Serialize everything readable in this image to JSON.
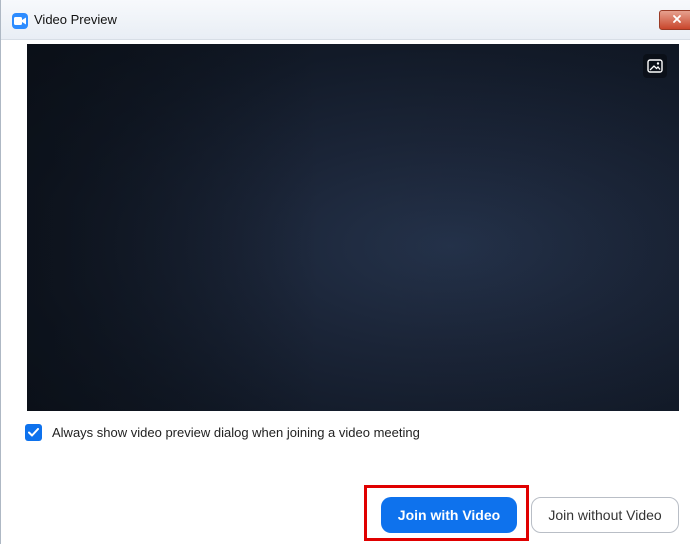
{
  "window": {
    "title": "Video Preview",
    "app_icon": "video-camera-icon",
    "close_icon": "close-icon"
  },
  "preview": {
    "background_icon": "image-background-icon"
  },
  "options": {
    "always_show_label": "Always show video preview dialog when joining a video meeting",
    "always_show_checked": true
  },
  "actions": {
    "join_with_video": "Join with Video",
    "join_without_video": "Join without Video"
  },
  "colors": {
    "accent": "#0e72ed",
    "highlight_box": "#e00000",
    "close_button": "#c9462c"
  }
}
